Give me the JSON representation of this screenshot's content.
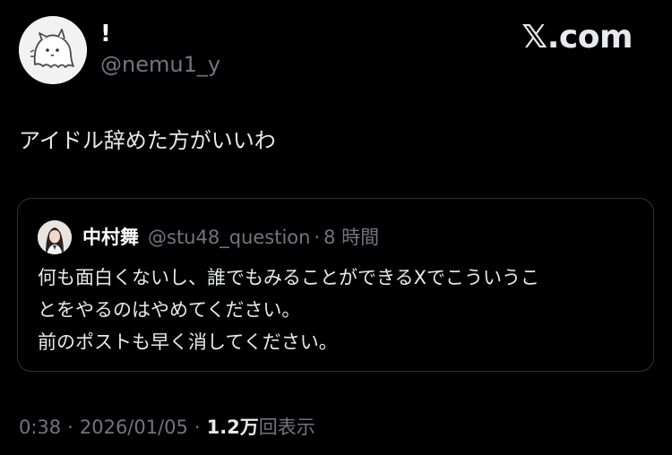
{
  "header": {
    "display_name": "!",
    "handle": "@nemu1_y",
    "brand": "𝕏.com"
  },
  "post": {
    "text": "アイドル辞めた方がいいわ"
  },
  "quote": {
    "name": "中村舞",
    "handle": "@stu48_question",
    "separator": "·",
    "time": "8 時間",
    "lines": [
      "何も面白くないし、誰でもみることができるXでこういうこ",
      "とをやるのはやめてください。",
      "前のポストも早く消してください。"
    ]
  },
  "footer": {
    "time": "0:38",
    "separator": "·",
    "date": "2026/01/05",
    "views_count": "1.2万",
    "views_label": "回表示"
  },
  "colors": {
    "background": "#000000",
    "text": "#e7e9ea",
    "muted": "#71767b",
    "border": "#2f3336"
  }
}
